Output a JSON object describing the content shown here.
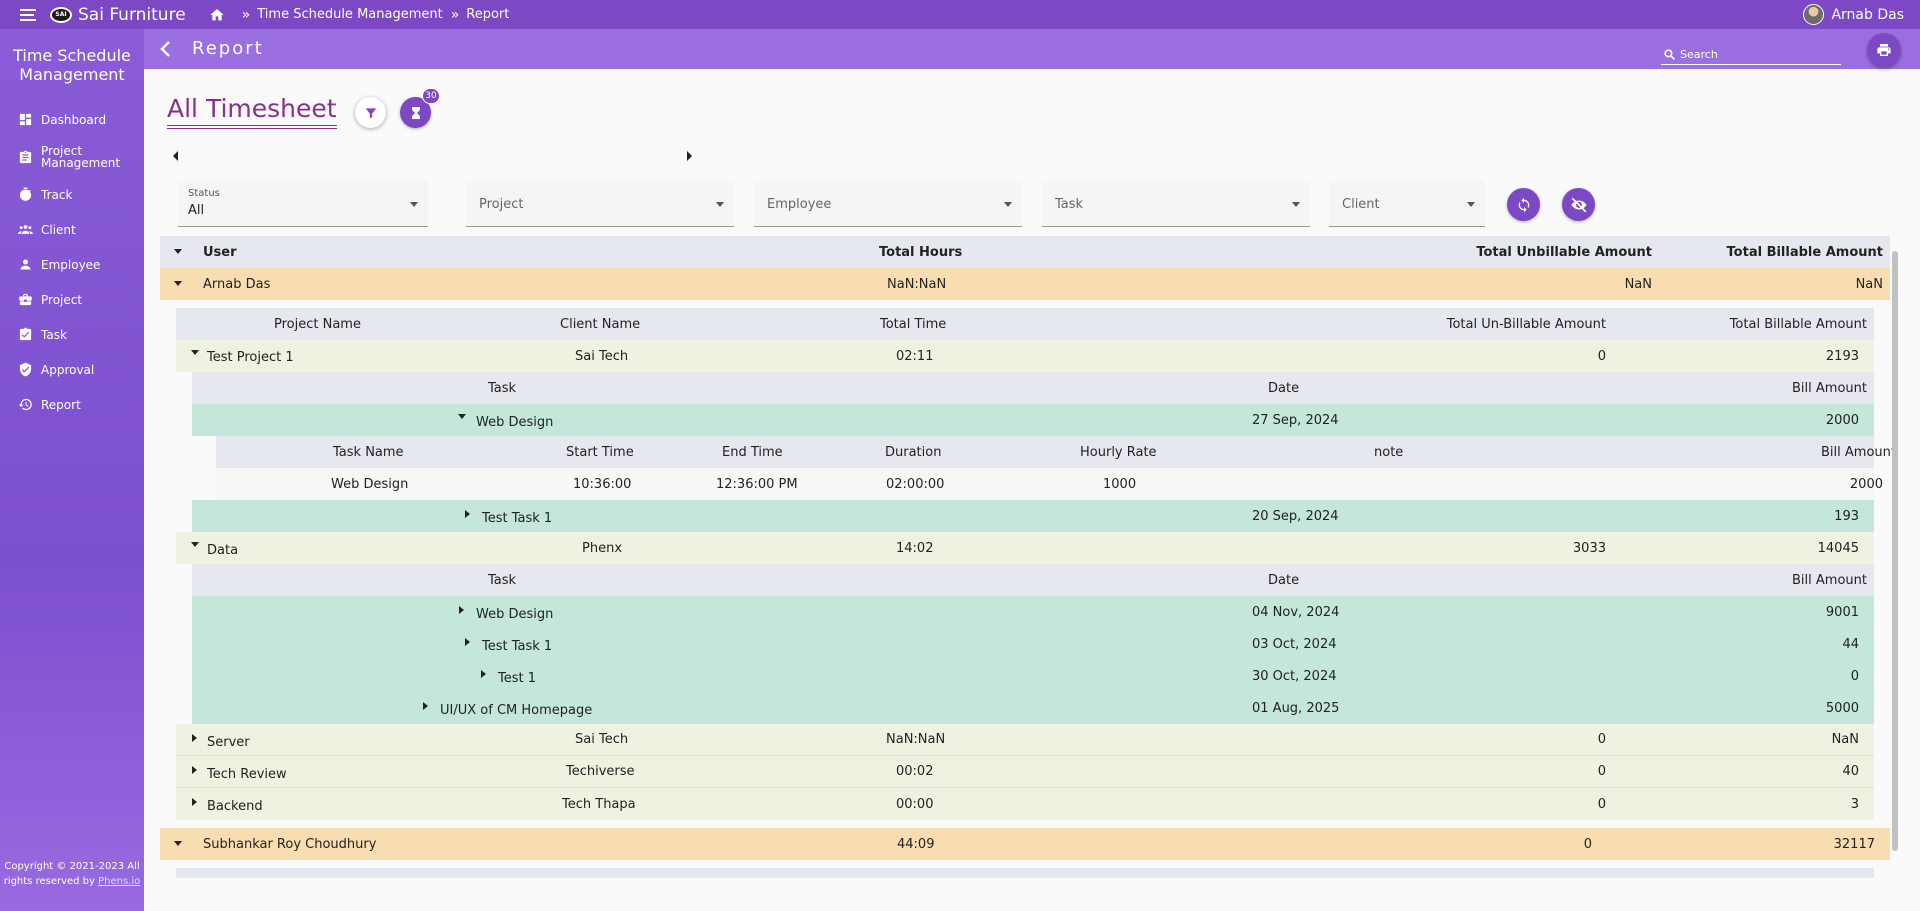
{
  "topbar": {
    "logo_text": "SAI",
    "brand": "Sai Furniture",
    "breadcrumb": [
      "Time Schedule Management",
      "Report"
    ],
    "user_name": "Arnab Das"
  },
  "sidebar": {
    "title": "Time Schedule Management",
    "items": [
      {
        "label": "Dashboard",
        "icon": "dashboard-icon"
      },
      {
        "label": "Project Management",
        "icon": "clipboard-icon"
      },
      {
        "label": "Track",
        "icon": "stopwatch-icon"
      },
      {
        "label": "Client",
        "icon": "group-icon"
      },
      {
        "label": "Employee",
        "icon": "person-icon"
      },
      {
        "label": "Project",
        "icon": "briefcase-icon"
      },
      {
        "label": "Task",
        "icon": "task-icon"
      },
      {
        "label": "Approval",
        "icon": "shield-check-icon"
      },
      {
        "label": "Report",
        "icon": "history-icon"
      }
    ],
    "copyright_1": "Copyright © 2021-2023 All",
    "copyright_2": "rights reserved by",
    "copyright_link": "Phens.io"
  },
  "subbar": {
    "title": "Report",
    "search_placeholder": "Search"
  },
  "page": {
    "heading": "All Timesheet",
    "badge_count": "30"
  },
  "filters": {
    "status_label": "Status",
    "status_value": "All",
    "project": "Project",
    "employee": "Employee",
    "task": "Task",
    "client": "Client"
  },
  "colors": {
    "primary": "#7c48c4",
    "user_row": "#f8ddb0",
    "project_row": "#eef3e1",
    "task_row": "#c5e6da",
    "header_row": "#e5e8ee"
  },
  "table": {
    "headers": {
      "user": "User",
      "total_hours": "Total Hours",
      "unbillable": "Total Unbillable Amount",
      "billable": "Total Billable Amount"
    },
    "project_headers": {
      "name": "Project Name",
      "client": "Client Name",
      "time": "Total Time",
      "unbillable": "Total Un-Billable Amount",
      "billable": "Total Billable Amount"
    },
    "task_headers": {
      "task": "Task",
      "date": "Date",
      "amount": "Bill Amount"
    },
    "detail_headers": {
      "name": "Task Name",
      "start": "Start Time",
      "end": "End Time",
      "duration": "Duration",
      "rate": "Hourly Rate",
      "note": "note",
      "amount": "Bill Amount"
    },
    "user1": {
      "name": "Arnab Das",
      "hours": "NaN:NaN",
      "unbillable": "NaN",
      "billable": "NaN"
    },
    "project1": {
      "name": "Test Project 1",
      "client": "Sai Tech",
      "time": "02:11",
      "unbillable": "0",
      "billable": "2193"
    },
    "p1_task1": {
      "name": "Web Design",
      "date": "27 Sep, 2024",
      "amount": "2000"
    },
    "p1_detail": {
      "name": "Web Design",
      "start": "10:36:00",
      "end": "12:36:00 PM",
      "duration": "02:00:00",
      "rate": "1000",
      "note": "",
      "amount": "2000"
    },
    "p1_task2": {
      "name": "Test Task 1",
      "date": "20 Sep, 2024",
      "amount": "193"
    },
    "project2": {
      "name": "Data",
      "client": "Phenx",
      "time": "14:02",
      "unbillable": "3033",
      "billable": "14045"
    },
    "p2_tasks": [
      {
        "name": "Web Design",
        "date": "04 Nov, 2024",
        "amount": "9001"
      },
      {
        "name": "Test Task 1",
        "date": "03 Oct, 2024",
        "amount": "44"
      },
      {
        "name": "Test 1",
        "date": "30 Oct, 2024",
        "amount": "0"
      },
      {
        "name": "UI/UX of CM Homepage",
        "date": "01 Aug, 2025",
        "amount": "5000"
      }
    ],
    "projects_collapsed": [
      {
        "name": "Server",
        "client": "Sai Tech",
        "time": "NaN:NaN",
        "unbillable": "0",
        "billable": "NaN"
      },
      {
        "name": "Tech Review",
        "client": "Techiverse",
        "time": "00:02",
        "unbillable": "0",
        "billable": "40"
      },
      {
        "name": "Backend",
        "client": "Tech Thapa",
        "time": "00:00",
        "unbillable": "0",
        "billable": "3"
      }
    ],
    "user2": {
      "name": "Subhankar Roy Choudhury",
      "hours": "44:09",
      "unbillable": "0",
      "billable": "32117"
    }
  }
}
